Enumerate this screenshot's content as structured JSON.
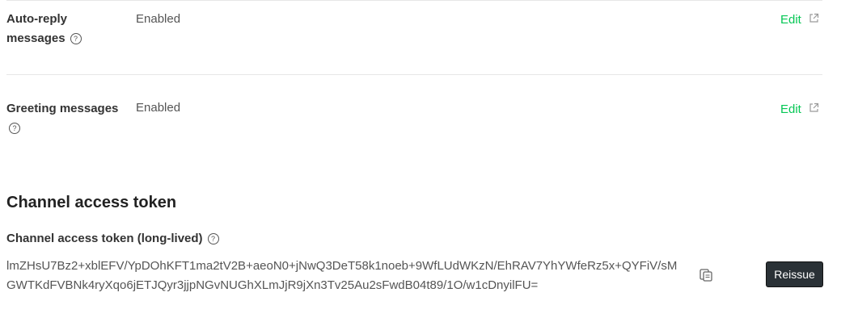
{
  "rows": [
    {
      "label_line1": "Auto-reply",
      "label_line2": "messages",
      "value": "Enabled",
      "action": "Edit"
    },
    {
      "label_line1": "Greeting messages",
      "value": "Enabled",
      "action": "Edit"
    }
  ],
  "help_glyph": "?",
  "token_section": {
    "title": "Channel access token",
    "subtitle": "Channel access token (long-lived)",
    "token_value": "lmZHsU7Bz2+xblEFV/YpDOhKFT1ma2tV2B+aeoN0+jNwQ3DeT58k1noeb+9WfLUdWKzN/EhRAV7YhYWfeRz5x+QYFiV/sMGWTKdFVBNk4ryXqo6jETJQyr3jjpNGvNUGhXLmJjR9jXn3Tv25Au2sFwdB04t89/1O/w1cDnyilFU=",
    "reissue_label": "Reissue"
  },
  "colors": {
    "accent": "#06c755",
    "button_bg": "#2a3136",
    "divider": "#e6e6e6"
  },
  "icons": [
    "help-circle-icon",
    "external-link-icon",
    "copy-icon"
  ]
}
